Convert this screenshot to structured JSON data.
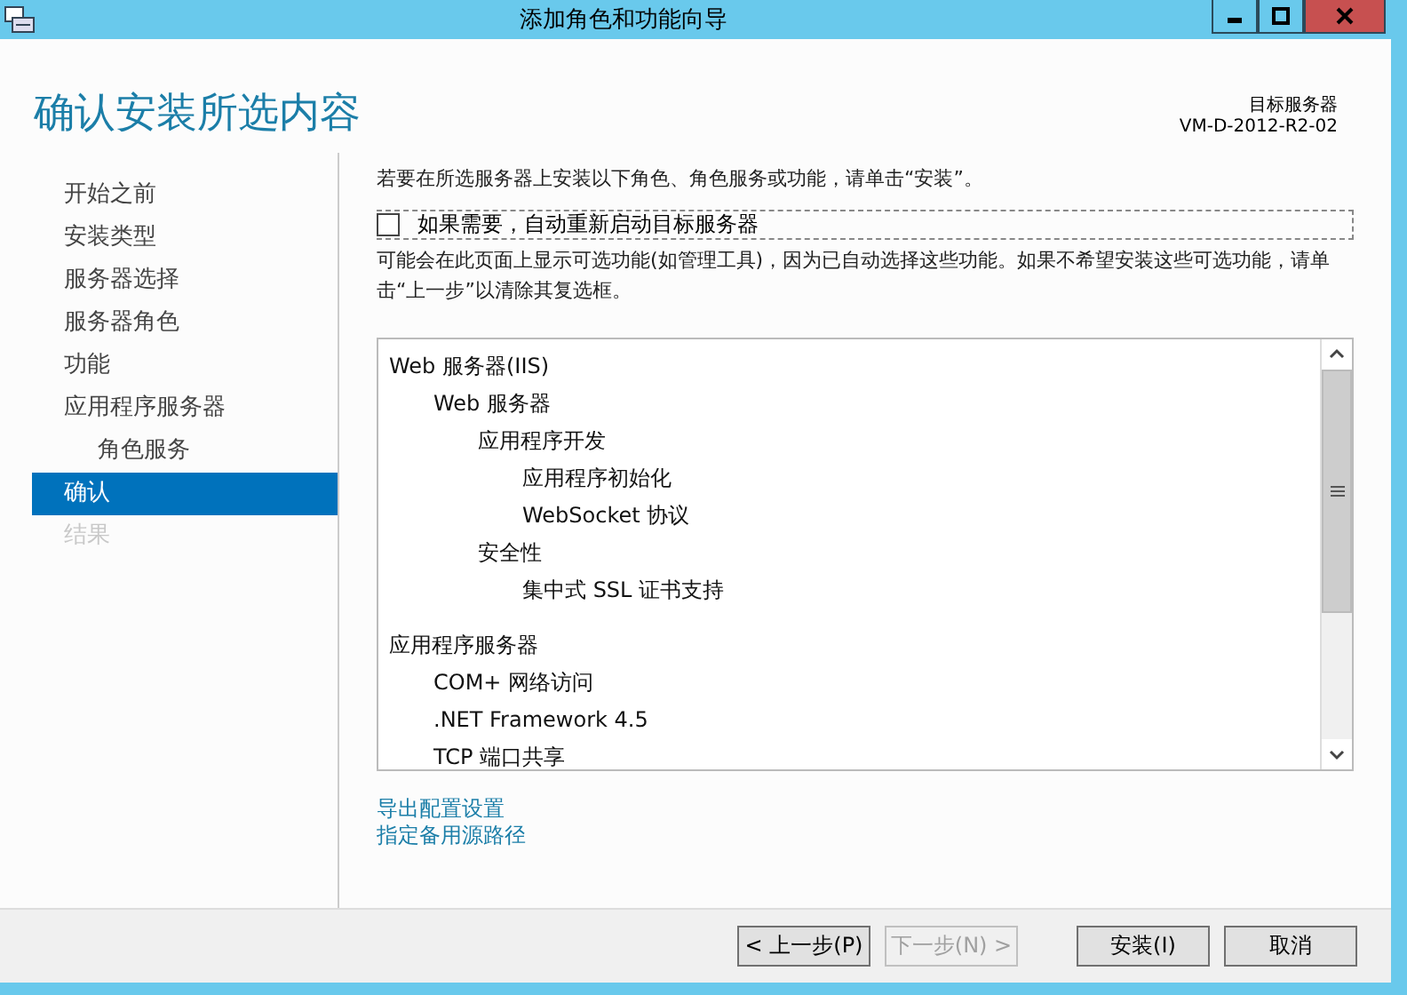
{
  "window": {
    "title": "添加角色和功能向导"
  },
  "header": {
    "title": "确认安装所选内容",
    "target_label": "目标服务器",
    "target_value": "VM-D-2012-R2-02"
  },
  "sidebar": {
    "items": [
      {
        "label": "开始之前",
        "selected": false,
        "disabled": false
      },
      {
        "label": "安装类型",
        "selected": false,
        "disabled": false
      },
      {
        "label": "服务器选择",
        "selected": false,
        "disabled": false
      },
      {
        "label": "服务器角色",
        "selected": false,
        "disabled": false
      },
      {
        "label": "功能",
        "selected": false,
        "disabled": false
      },
      {
        "label": "应用程序服务器",
        "selected": false,
        "disabled": false,
        "children": [
          {
            "label": "角色服务",
            "selected": false,
            "disabled": false
          }
        ]
      },
      {
        "label": "确认",
        "selected": true,
        "disabled": false
      },
      {
        "label": "结果",
        "selected": false,
        "disabled": true
      }
    ]
  },
  "content": {
    "intro": "若要在所选服务器上安装以下角色、角色服务或功能，请单击“安装”。",
    "restart_option": {
      "label": "如果需要，自动重新启动目标服务器",
      "checked": false
    },
    "note": "可能会在此页面上显示可选功能(如管理工具)，因为已自动选择这些功能。如果不希望安装这些可选功能，请单击“上一步”以清除其复选框。",
    "selection_tree": [
      {
        "label": "Web 服务器(IIS)",
        "children": [
          {
            "label": "Web 服务器",
            "children": [
              {
                "label": "应用程序开发",
                "children": [
                  {
                    "label": "应用程序初始化"
                  },
                  {
                    "label": "WebSocket 协议"
                  }
                ]
              },
              {
                "label": "安全性",
                "children": [
                  {
                    "label": "集中式 SSL 证书支持"
                  }
                ]
              }
            ]
          }
        ]
      },
      {
        "label": "应用程序服务器",
        "children": [
          {
            "label": "COM+ 网络访问"
          },
          {
            "label": ".NET Framework 4.5"
          },
          {
            "label": "TCP 端口共享"
          }
        ]
      }
    ],
    "links": [
      "导出配置设置",
      "指定备用源路径"
    ]
  },
  "buttons": [
    {
      "label": "< 上一步(P)",
      "disabled": false
    },
    {
      "label": "下一步(N) >",
      "disabled": true
    },
    {
      "label": "安装(I)",
      "disabled": false
    },
    {
      "label": "取消",
      "disabled": false
    }
  ]
}
